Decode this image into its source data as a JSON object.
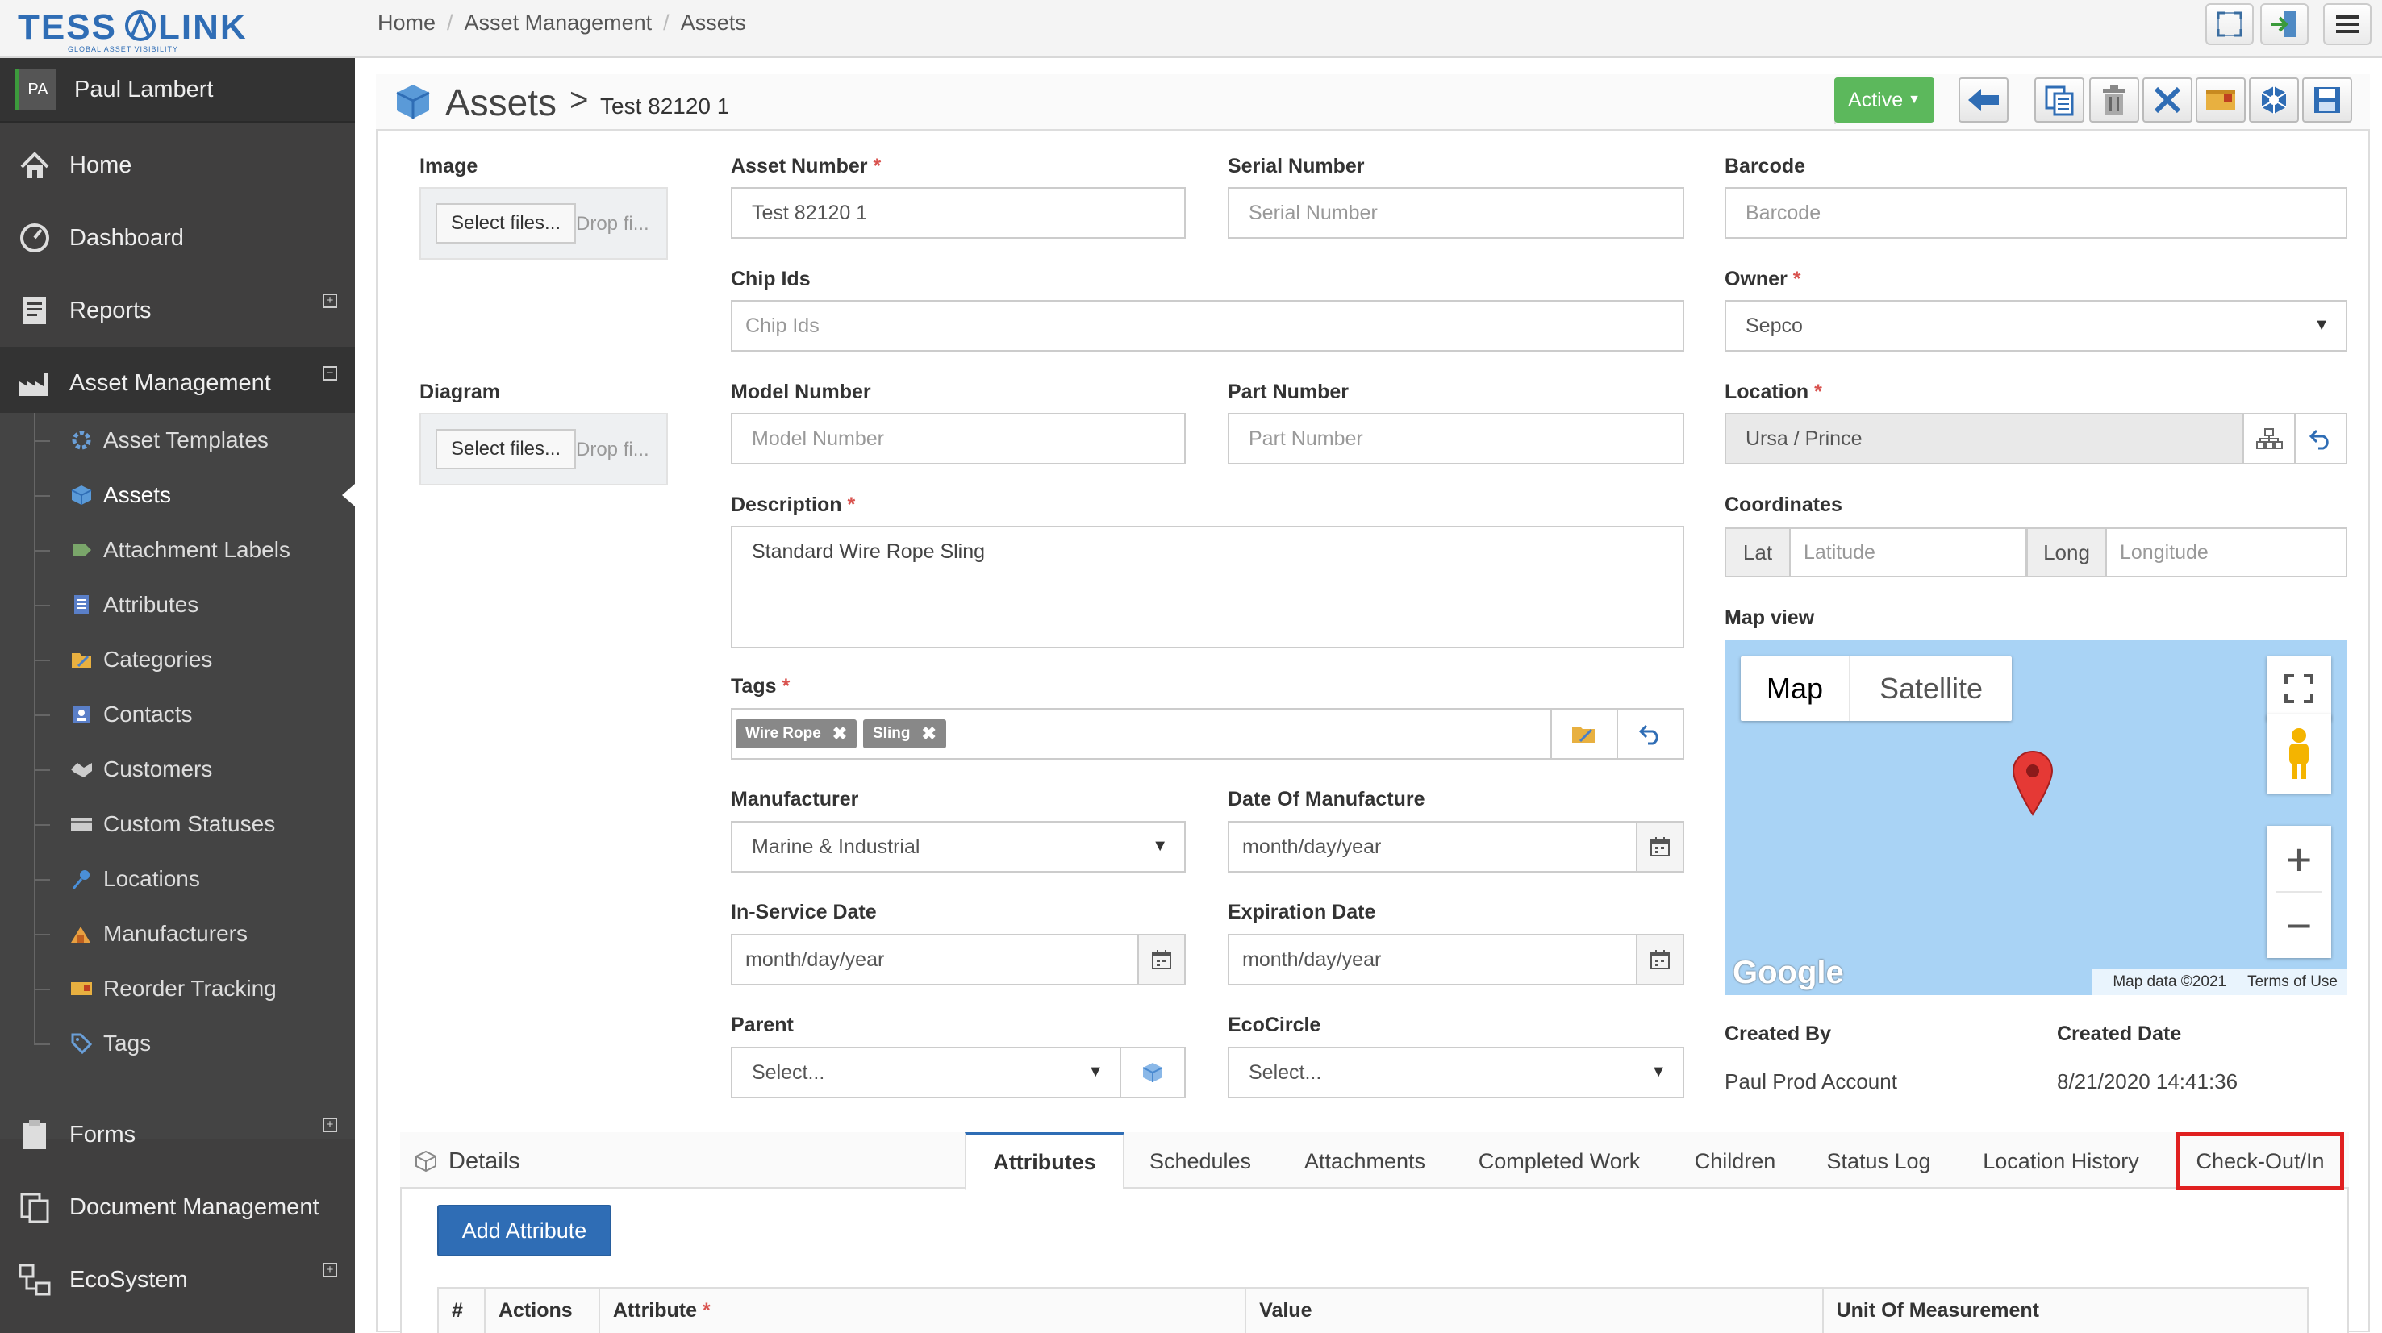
{
  "brand": {
    "logo_text": "TESSALINK",
    "tagline": "GLOBAL ASSET VISIBILITY"
  },
  "breadcrumb": [
    "Home",
    "Asset Management",
    "Assets"
  ],
  "user": {
    "initials": "PA",
    "name": "Paul Lambert"
  },
  "nav": {
    "home": "Home",
    "dashboard": "Dashboard",
    "reports": "Reports",
    "asset_management": "Asset Management",
    "sub": [
      "Asset Templates",
      "Assets",
      "Attachment Labels",
      "Attributes",
      "Categories",
      "Contacts",
      "Customers",
      "Custom Statuses",
      "Locations",
      "Manufacturers",
      "Reorder Tracking",
      "Tags"
    ],
    "forms": "Forms",
    "document_management": "Document Management",
    "ecosystem": "EcoSystem"
  },
  "header": {
    "title": "Assets",
    "separator": ">",
    "subtitle": "Test 82120 1",
    "status": "Active"
  },
  "form": {
    "image_label": "Image",
    "diagram_label": "Diagram",
    "select_files": "Select files...",
    "drop_files": "Drop fi...",
    "asset_number_label": "Asset Number",
    "asset_number": "Test 82120 1",
    "serial_label": "Serial Number",
    "serial_ph": "Serial Number",
    "barcode_label": "Barcode",
    "barcode_ph": "Barcode",
    "chip_label": "Chip Ids",
    "chip_ph": "Chip Ids",
    "owner_label": "Owner",
    "owner": "Sepco",
    "model_label": "Model Number",
    "model_ph": "Model Number",
    "part_label": "Part Number",
    "part_ph": "Part Number",
    "location_label": "Location",
    "location": "Ursa / Prince",
    "desc_label": "Description",
    "desc": "Standard Wire Rope Sling",
    "coords_label": "Coordinates",
    "lat": "Lat",
    "lat_ph": "Latitude",
    "long": "Long",
    "long_ph": "Longitude",
    "mapview_label": "Map view",
    "tags_label": "Tags",
    "tags": [
      "Wire Rope",
      "Sling"
    ],
    "manufacturer_label": "Manufacturer",
    "manufacturer": "Marine & Industrial",
    "dom_label": "Date Of Manufacture",
    "date_ph": "month/day/year",
    "inservice_label": "In-Service Date",
    "expiration_label": "Expiration Date",
    "parent_label": "Parent",
    "select_ph": "Select...",
    "ecocircle_label": "EcoCircle",
    "created_by_label": "Created By",
    "created_by": "Paul Prod Account",
    "created_date_label": "Created Date",
    "created_date": "8/21/2020 14:41:36"
  },
  "map": {
    "map_btn": "Map",
    "satellite_btn": "Satellite",
    "google": "Google",
    "map_data": "Map data ©2021",
    "terms": "Terms of Use"
  },
  "details": {
    "title": "Details",
    "tabs": [
      "Attributes",
      "Schedules",
      "Attachments",
      "Completed Work",
      "Children",
      "Status Log",
      "Location History",
      "Check-Out/In"
    ],
    "add_btn": "Add Attribute",
    "columns": [
      "#",
      "Actions",
      "Attribute",
      "Value",
      "Unit Of Measurement"
    ]
  },
  "colors": {
    "sidebar": "#403f3f",
    "active_green": "#5cb85c",
    "primary_blue": "#2f6db5",
    "highlight_red": "#e02020"
  }
}
